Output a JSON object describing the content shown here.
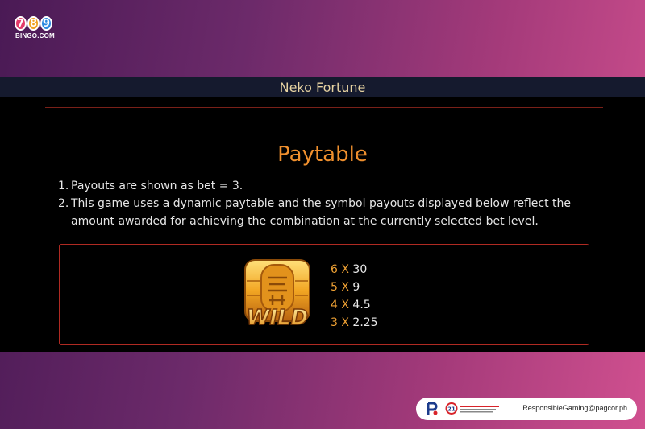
{
  "brand": {
    "digits": [
      "7",
      "8",
      "9"
    ],
    "sub": "BINGO.COM"
  },
  "game_title": "Neko Fortune",
  "paytable": {
    "heading": "Paytable",
    "notes": [
      {
        "num": "1.",
        "text": "Payouts are shown as bet = 3."
      },
      {
        "num": "2.",
        "text": "This game uses a dynamic paytable and the symbol payouts displayed below reflect the amount awarded for achieving the combination at the currently selected bet level."
      }
    ],
    "symbol": {
      "icon": "wild-coin-icon",
      "label": "WILD",
      "payouts": [
        {
          "count": "6 X",
          "value": "30"
        },
        {
          "count": "5 X",
          "value": "9"
        },
        {
          "count": "4 X",
          "value": "4.5"
        },
        {
          "count": "3 X",
          "value": "2.25"
        }
      ]
    }
  },
  "footer": {
    "email": "ResponsibleGaming@pagcor.ph",
    "badge": "21"
  },
  "colors": {
    "title_text": "#e7d3a2",
    "heading": "#f0902e",
    "payout_count": "#f0a234",
    "border": "#b02a22"
  }
}
